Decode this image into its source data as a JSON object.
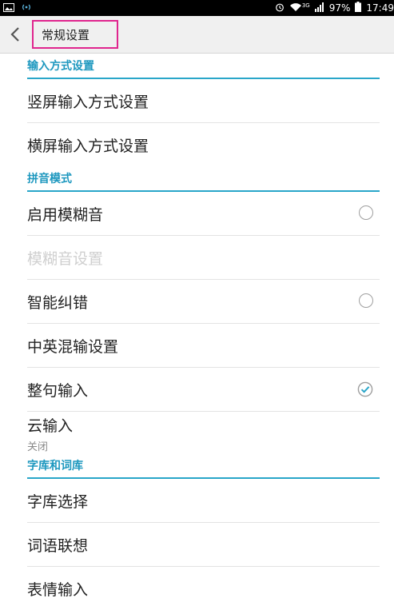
{
  "status_bar": {
    "battery_percent": "97%",
    "network": "3G",
    "time": "17:49"
  },
  "app_bar": {
    "title": "常规设置"
  },
  "sections": [
    {
      "header": "输入方式设置",
      "items": [
        {
          "label": "竖屏输入方式设置"
        },
        {
          "label": "横屏输入方式设置"
        }
      ]
    },
    {
      "header": "拼音模式",
      "items": [
        {
          "label": "启用模糊音",
          "checked": false
        },
        {
          "label": "模糊音设置",
          "disabled": true
        },
        {
          "label": "智能纠错",
          "checked": false
        },
        {
          "label": "中英混输设置"
        },
        {
          "label": "整句输入",
          "checked": true
        },
        {
          "label": "云输入",
          "summary": "关闭"
        }
      ]
    },
    {
      "header": "字库和词库",
      "items": [
        {
          "label": "字库选择"
        },
        {
          "label": "词语联想"
        },
        {
          "label": "表情输入"
        }
      ]
    }
  ],
  "colors": {
    "accent": "#29a6c9",
    "highlight_box": "#e0258e"
  }
}
